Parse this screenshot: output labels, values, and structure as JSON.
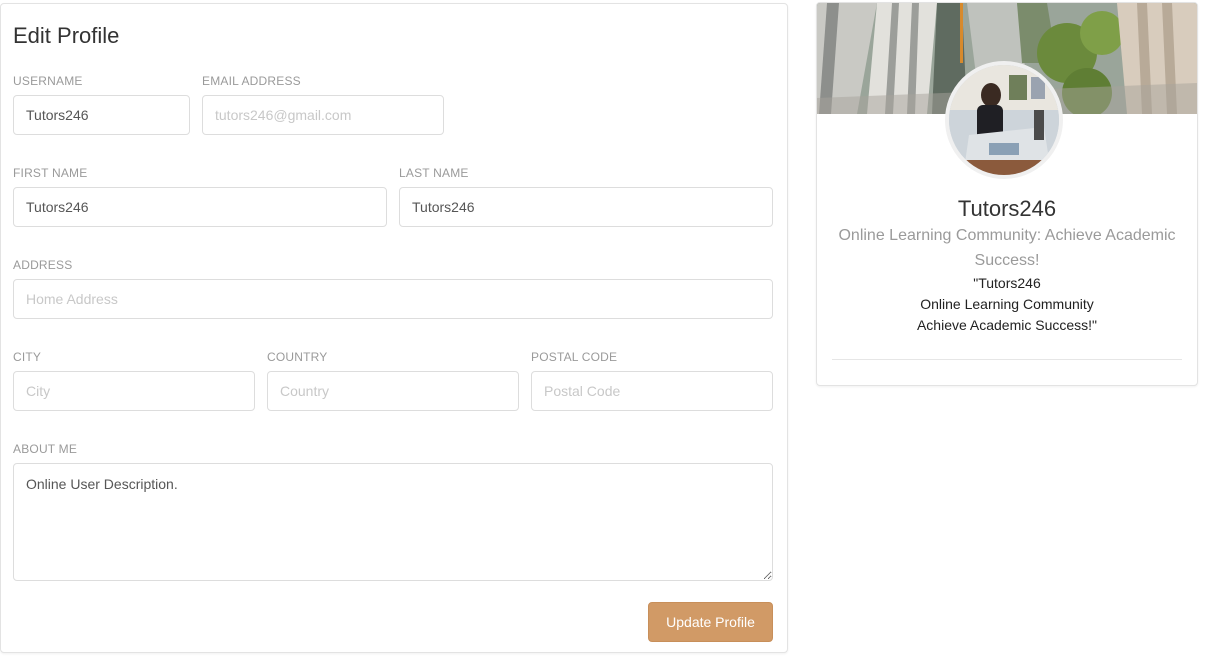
{
  "edit_profile": {
    "title": "Edit Profile",
    "username": {
      "label": "USERNAME",
      "value": "Tutors246"
    },
    "email": {
      "label": "EMAIL ADDRESS",
      "placeholder": "tutors246@gmail.com"
    },
    "first_name": {
      "label": "FIRST NAME",
      "value": "Tutors246"
    },
    "last_name": {
      "label": "LAST NAME",
      "value": "Tutors246"
    },
    "address": {
      "label": "ADDRESS",
      "placeholder": "Home Address"
    },
    "city": {
      "label": "CITY",
      "placeholder": "City"
    },
    "country": {
      "label": "COUNTRY",
      "placeholder": "Country"
    },
    "postal_code": {
      "label": "POSTAL CODE",
      "placeholder": "Postal Code"
    },
    "about_me": {
      "label": "ABOUT ME",
      "value": "Online User Description."
    },
    "submit_label": "Update Profile"
  },
  "profile_card": {
    "name": "Tutors246",
    "tagline": "Online Learning Community: Achieve Academic Success!",
    "description": [
      "\"Tutors246",
      "Online Learning Community",
      "Achieve Academic Success!\""
    ]
  },
  "colors": {
    "accent_button": "#d19a66",
    "label_gray": "#9a9a9a",
    "border": "#dddddd"
  }
}
